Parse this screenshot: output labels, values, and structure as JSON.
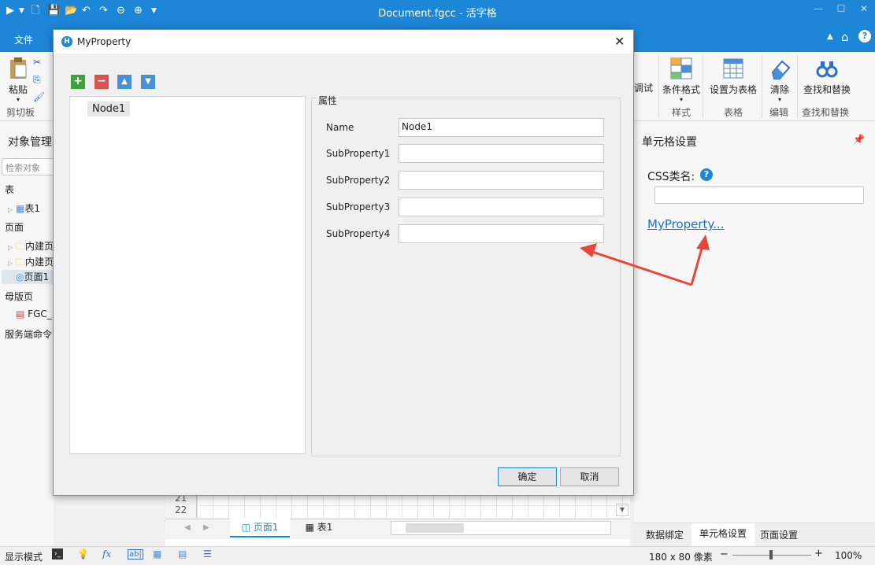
{
  "app": {
    "window_title": "Document.fgcc - 活字格",
    "file_tab": "文件"
  },
  "ribbon": {
    "paste": "粘贴",
    "clipboard_group": "剪切板",
    "debug": "调试",
    "cond_format": "条件格式",
    "style_group": "样式",
    "set_table": "设置为表格",
    "table_group": "表格",
    "clear": "清除",
    "edit_group": "编辑",
    "find_replace": "查找和替换",
    "find_group": "查找和替换"
  },
  "left_panel": {
    "title": "对象管理",
    "search_placeholder": "检索对象",
    "tables_header": "表",
    "table1": "表1",
    "pages_header": "页面",
    "builtin1": "内建页",
    "builtin2": "内建页",
    "page1": "页面1",
    "master_header": "母版页",
    "master_item": "FGC_",
    "server_header": "服务端命令"
  },
  "right_panel": {
    "title": "单元格设置",
    "css_label": "CSS类名:",
    "help": "?",
    "css_value": "",
    "link": "MyProperty...",
    "tabs": [
      "数据绑定",
      "单元格设置",
      "页面设置"
    ]
  },
  "sheet": {
    "row21": "21",
    "row22": "22",
    "tab_page": "页面1",
    "tab_table": "表1"
  },
  "status": {
    "mode": "显示模式",
    "size": "180 x 80 像素",
    "zoom": "100%"
  },
  "dialog": {
    "title": "MyProperty",
    "tree_node": "Node1",
    "group_label": "属性",
    "fields": [
      {
        "label": "Name",
        "value": "Node1"
      },
      {
        "label": "SubProperty1",
        "value": ""
      },
      {
        "label": "SubProperty2",
        "value": ""
      },
      {
        "label": "SubProperty3",
        "value": ""
      },
      {
        "label": "SubProperty4",
        "value": ""
      }
    ],
    "ok": "确定",
    "cancel": "取消",
    "add_symbol": "+",
    "remove_symbol": "−"
  },
  "colors": {
    "accent": "#1d86d6",
    "arrow": "#e8453c",
    "add": "#3aa53a",
    "remove": "#d9534f",
    "move": "#4a90d9"
  }
}
